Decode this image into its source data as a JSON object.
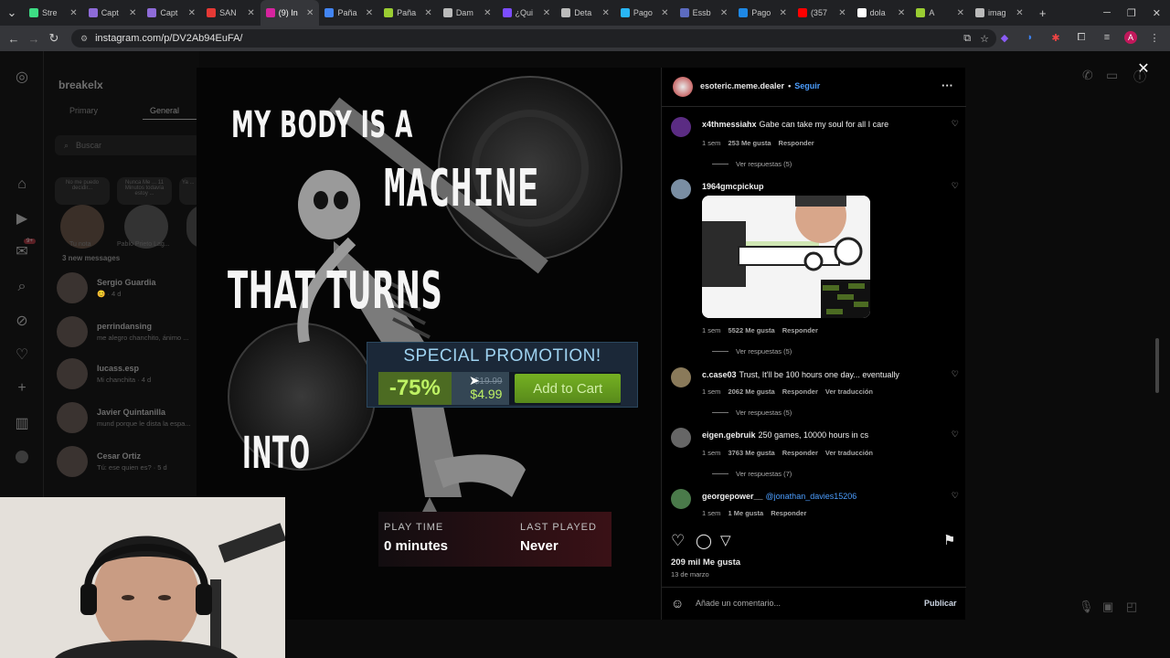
{
  "browser": {
    "tabs": [
      {
        "label": "Stre",
        "color": "#3ddc84"
      },
      {
        "label": "Capt",
        "color": "#8e6bd8"
      },
      {
        "label": "Capt",
        "color": "#8e6bd8"
      },
      {
        "label": "SAN",
        "color": "#e53935"
      },
      {
        "label": "(9) In",
        "color": "#d6249f",
        "active": true
      },
      {
        "label": "Paña",
        "color": "#4285f4"
      },
      {
        "label": "Paña",
        "color": "#9acd32"
      },
      {
        "label": "Dam",
        "color": "#bbbbbb"
      },
      {
        "label": "¿Qui",
        "color": "#7c4dff"
      },
      {
        "label": "Deta",
        "color": "#bbbbbb"
      },
      {
        "label": "Pago",
        "color": "#29b6f6"
      },
      {
        "label": "Essb",
        "color": "#5c6bc0"
      },
      {
        "label": "Pago",
        "color": "#1e88e5"
      },
      {
        "label": "(357",
        "color": "#ff0000"
      },
      {
        "label": "dola",
        "color": "#ffffff"
      },
      {
        "label": "A",
        "color": "#9acd32"
      },
      {
        "label": "imag",
        "color": "#bbbbbb"
      }
    ],
    "new_tab": "+",
    "url": "instagram.com/p/DV2Ab94EuFA/"
  },
  "sidebar_dm": {
    "account": "breakelx",
    "tabs": [
      "Primary",
      "General"
    ],
    "search_placeholder": "Buscar",
    "notes": [
      {
        "text": "No me puedo decidir..."
      },
      {
        "text": "Nunca Me ... 11 Minutos todavía estoy ..."
      },
      {
        "text": "Ya ..."
      }
    ],
    "note_labels": [
      "Tu nota",
      "Pablo Prieto Lag..."
    ],
    "new_messages": "3 new messages",
    "chats": [
      {
        "name": "Sergio Guardia",
        "sub": "😊 · 4 d"
      },
      {
        "name": "perrindansing",
        "sub": "me alegro chanchito, ánimo ..."
      },
      {
        "name": "lucass.esp",
        "sub": "Mi chanchita · 4 d"
      },
      {
        "name": "Javier Quintanilla",
        "sub": "mund porque le dista la espa..."
      },
      {
        "name": "Cesar Ortiz",
        "sub": "Tú: ese quien es? · 5 d"
      }
    ],
    "badge": "9+"
  },
  "meme": {
    "line1": "MY BODY IS A",
    "line2": "MACHINE",
    "line3": "THAT TURNS",
    "line4": "INTO",
    "promo_title": "SPECIAL PROMOTION!",
    "discount": "-75%",
    "old_price": "$19.99",
    "new_price": "$4.99",
    "cart_button": "Add to Cart",
    "playtime_label": "PLAY TIME",
    "playtime_value": "0 minutes",
    "lastplayed_label": "LAST PLAYED",
    "lastplayed_value": "Never"
  },
  "post": {
    "author": "esoteric.meme.dealer",
    "separator": "•",
    "follow": "Seguir",
    "more": "···",
    "comments": [
      {
        "user": "x4thmessiahx",
        "text": "Gabe can take my soul for all I care",
        "time": "1 sem",
        "likes": "253 Me gusta",
        "reply": "Responder",
        "translate": "",
        "view_replies": "Ver respuestas (5)"
      },
      {
        "user": "1964gmcpickup",
        "text": "",
        "time": "1 sem",
        "likes": "5522 Me gusta",
        "reply": "Responder",
        "translate": "",
        "view_replies": "Ver respuestas (5)"
      },
      {
        "user": "c.case03",
        "text": "Trust, It'll be 100 hours one day... eventually",
        "time": "1 sem",
        "likes": "2062 Me gusta",
        "reply": "Responder",
        "translate": "Ver traducción",
        "view_replies": "Ver respuestas (5)"
      },
      {
        "user": "eigen.gebruik",
        "text": "250 games, 10000 hours in cs",
        "time": "1 sem",
        "likes": "3763 Me gusta",
        "reply": "Responder",
        "translate": "Ver traducción",
        "view_replies": "Ver respuestas (7)"
      },
      {
        "user": "georgepower__",
        "text": "@jonathan_davies15206",
        "time": "1 sem",
        "likes": "1 Me gusta",
        "reply": "Responder",
        "translate": "",
        "view_replies": ""
      }
    ],
    "likes_total": "209 mil Me gusta",
    "date": "13 de marzo",
    "comment_placeholder": "Añade un comentario...",
    "publish": "Publicar",
    "reaction_image_tags": [
      "-9000%",
      "-99%",
      "-90%",
      "-80%",
      "-50%",
      "-60%"
    ]
  },
  "colors": {
    "steam_green": "#4c6b22",
    "steam_price_bg": "#344654",
    "steam_promo": "#1b2838",
    "ig_link": "#4c9eff"
  }
}
